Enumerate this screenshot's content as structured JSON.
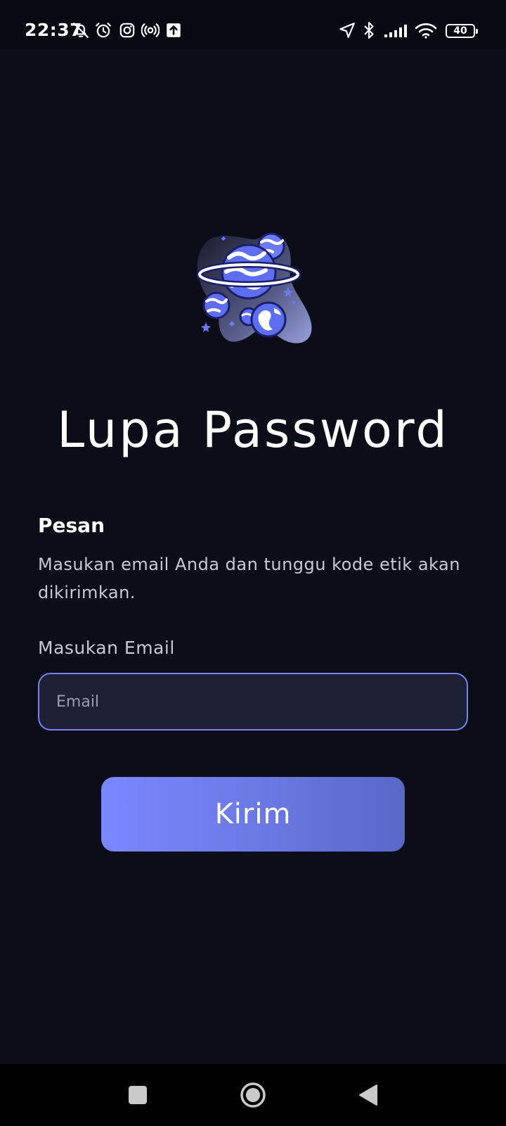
{
  "status_bar": {
    "time": "22:37",
    "battery_level": "40",
    "icons": [
      "bell-off-icon",
      "alarm-icon",
      "instagram-icon",
      "location-broadcast-icon",
      "upload-icon",
      "navigation-arrow-icon",
      "bluetooth-icon",
      "signal-icon",
      "wifi-icon",
      "battery-icon"
    ]
  },
  "page": {
    "title": "Lupa Password",
    "section_heading": "Pesan",
    "message": "Masukan email Anda dan tunggu kode etik akan dikirimkan.",
    "email_label": "Masukan Email",
    "email_placeholder": "Email",
    "email_value": "",
    "submit_label": "Kirim"
  },
  "nav_bar": {
    "buttons": [
      "recent-apps-button",
      "home-button",
      "back-button"
    ]
  },
  "colors": {
    "background": "#0b0d19",
    "accent": "#7b87ff",
    "input_bg": "#1d2035",
    "input_border": "#7b82f0"
  }
}
